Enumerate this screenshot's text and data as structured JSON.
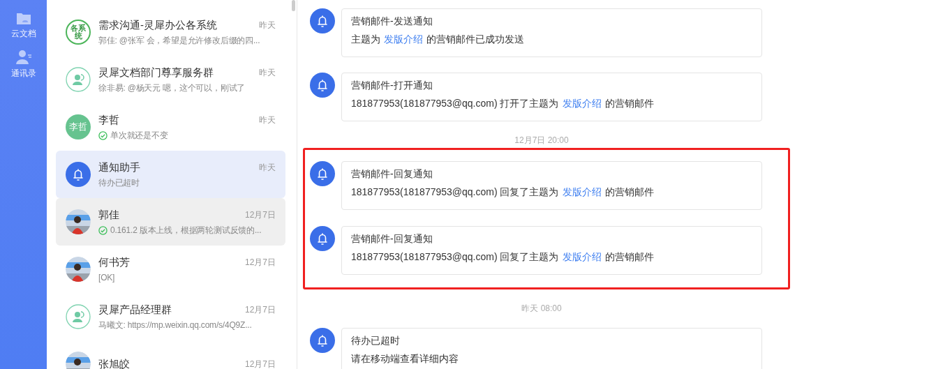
{
  "rail": [
    {
      "kind": "folder",
      "label": "云文档"
    },
    {
      "kind": "contacts",
      "label": "通讯录"
    }
  ],
  "conversations": [
    {
      "name": "需求沟通-灵犀办公各系统",
      "time": "昨天",
      "preview": "郭佳: @张军 会，希望是允许修改后缀的四...",
      "check": false,
      "avatar": {
        "kind": "ring-text",
        "text": "各系统"
      },
      "selected": false,
      "hovered": false
    },
    {
      "name": "灵犀文档部门尊享服务群",
      "time": "昨天",
      "preview": "徐非易: @杨天元 嗯，这个可以，刚试了",
      "check": false,
      "avatar": {
        "kind": "group"
      },
      "selected": false,
      "hovered": false
    },
    {
      "name": "李哲",
      "time": "昨天",
      "preview": "单次就还是不变",
      "check": true,
      "avatar": {
        "kind": "text",
        "text": "李哲"
      },
      "selected": false,
      "hovered": false
    },
    {
      "name": "通知助手",
      "time": "昨天",
      "preview": "待办已超时",
      "check": false,
      "avatar": {
        "kind": "bell"
      },
      "selected": true,
      "hovered": false
    },
    {
      "name": "郭佳",
      "time": "12月7日",
      "preview": "0.161.2 版本上线，根据两轮测试反馈的...",
      "check": true,
      "selected": false,
      "hovered": true
    },
    {
      "name": "何书芳",
      "time": "12月7日",
      "preview": "[OK]",
      "check": false,
      "selected": false,
      "hovered": false
    },
    {
      "name": "灵犀产品经理群",
      "time": "12月7日",
      "preview": "马曦文: https://mp.weixin.qq.com/s/4Q9Z...",
      "check": false,
      "avatar": {
        "kind": "group"
      },
      "selected": false,
      "hovered": false
    },
    {
      "name": "张旭皎",
      "time": "12月7日",
      "selected": false,
      "hovered": false
    }
  ],
  "feed": [
    {
      "kind": "message",
      "title": "营销邮件-发送通知",
      "body": {
        "before": "主题为",
        "link": "发版介绍",
        "after": "的营销邮件已成功发送"
      }
    },
    {
      "kind": "message",
      "title": "营销邮件-打开通知",
      "body": {
        "before": "181877953(181877953@qq.com) 打开了主题为",
        "link": "发版介绍",
        "after": "的营销邮件"
      }
    },
    {
      "kind": "time",
      "text": "12月7日 20:00"
    },
    {
      "kind": "highlight",
      "messages": [
        {
          "title": "营销邮件-回复通知",
          "body": {
            "before": "181877953(181877953@qq.com) 回复了主题为",
            "link": "发版介绍",
            "after": "的营销邮件"
          }
        },
        {
          "title": "营销邮件-回复通知",
          "body": {
            "before": "181877953(181877953@qq.com) 回复了主题为",
            "link": "发版介绍",
            "after": "的营销邮件"
          }
        }
      ]
    },
    {
      "kind": "time",
      "text": "昨天 08:00"
    },
    {
      "kind": "message",
      "title": "待办已超时",
      "body": {
        "before": "请在移动端查看详细内容"
      }
    }
  ]
}
